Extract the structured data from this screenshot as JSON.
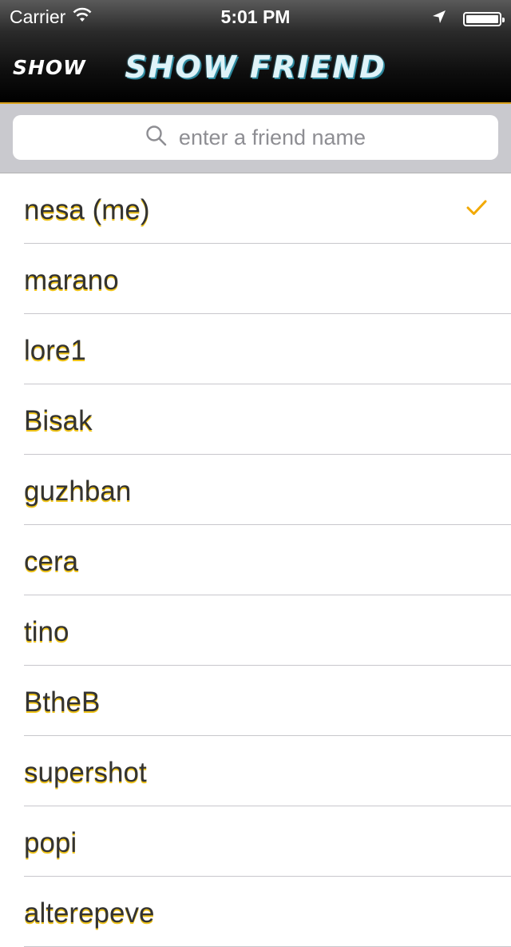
{
  "status_bar": {
    "carrier": "Carrier",
    "time": "5:01 PM",
    "battery_level": 1.0
  },
  "nav": {
    "back_label": "Show",
    "title": "Show Friend"
  },
  "search": {
    "placeholder": "enter a friend name"
  },
  "friends": [
    {
      "name": "nesa (me)",
      "selected": true
    },
    {
      "name": "marano",
      "selected": false
    },
    {
      "name": "lore1",
      "selected": false
    },
    {
      "name": "Bisak",
      "selected": false
    },
    {
      "name": "guzhban",
      "selected": false
    },
    {
      "name": "cera",
      "selected": false
    },
    {
      "name": "tino",
      "selected": false
    },
    {
      "name": "BtheB",
      "selected": false
    },
    {
      "name": "supershot",
      "selected": false
    },
    {
      "name": "popi",
      "selected": false
    },
    {
      "name": "alterepeve",
      "selected": false
    }
  ],
  "colors": {
    "accent": "#f2a900",
    "label_shadow": "#f0c419",
    "title": "#dff3f8"
  }
}
